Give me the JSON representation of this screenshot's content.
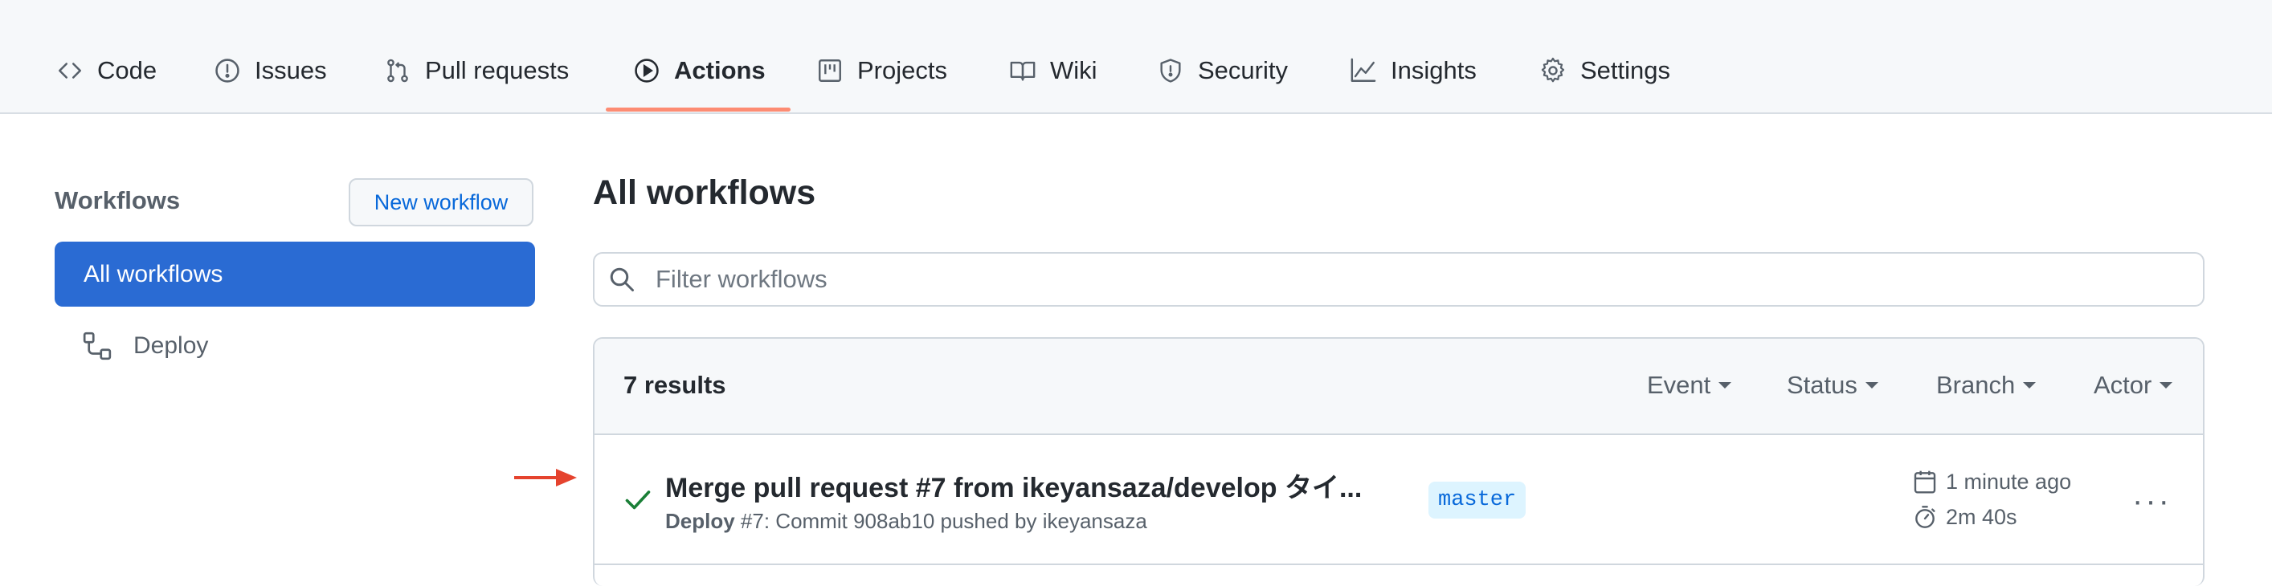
{
  "nav": {
    "tabs": [
      {
        "label": "Code",
        "icon": "code-icon"
      },
      {
        "label": "Issues",
        "icon": "issue-icon"
      },
      {
        "label": "Pull requests",
        "icon": "pull-request-icon"
      },
      {
        "label": "Actions",
        "icon": "play-icon",
        "active": true
      },
      {
        "label": "Projects",
        "icon": "project-icon"
      },
      {
        "label": "Wiki",
        "icon": "book-icon"
      },
      {
        "label": "Security",
        "icon": "shield-icon"
      },
      {
        "label": "Insights",
        "icon": "graph-icon"
      },
      {
        "label": "Settings",
        "icon": "gear-icon"
      }
    ],
    "active_underline_color": "#fd8c73"
  },
  "sidebar": {
    "heading": "Workflows",
    "new_workflow_label": "New workflow",
    "items": [
      {
        "label": "All workflows",
        "active": true
      },
      {
        "label": "Deploy",
        "icon": "workflow-icon"
      }
    ],
    "active_color": "#2a6bd3"
  },
  "main": {
    "title": "All workflows",
    "filter_placeholder": "Filter workflows",
    "results_count": "7 results",
    "filters": [
      "Event",
      "Status",
      "Branch",
      "Actor"
    ],
    "runs": [
      {
        "status": "success",
        "status_icon": "check-icon",
        "title": "Merge pull request #7 from ikeyansaza/develop タイ...",
        "workflow": "Deploy",
        "run_number": "#7",
        "commit_text": ": Commit 908ab10 pushed by ikeyansaza",
        "branch": "master",
        "time_ago": "1 minute ago",
        "duration": "2m 40s"
      }
    ]
  },
  "annotation": {
    "arrow_color": "#e5432e",
    "arrow_icon": "arrow-right-icon"
  }
}
